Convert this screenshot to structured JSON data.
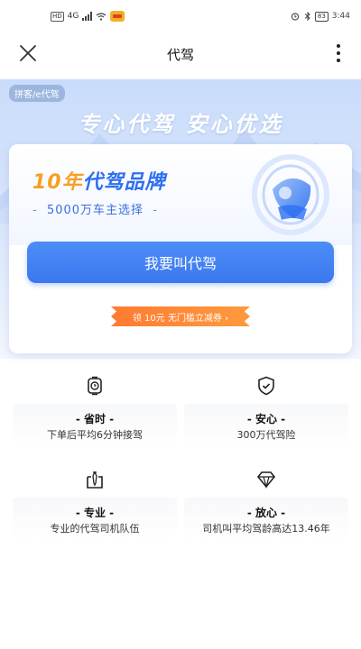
{
  "status_bar": {
    "network_hd": "HD",
    "network_type": "4G",
    "battery": "83",
    "time": "3:44"
  },
  "nav": {
    "title": "代驾",
    "icons": {
      "close": "close-icon",
      "more": "more-vertical-icon"
    }
  },
  "hero": {
    "tag": "拼客/e代驾",
    "slogan": "专心代驾 安心优选",
    "brand_prefix": "10年",
    "brand_suffix": "代驾品牌",
    "sub_dash_left": "-",
    "subtitle": "5000万车主选择",
    "sub_dash_right": "-",
    "call_button": "我要叫代驾",
    "coupon": "领 10元 无门槛立减券 ›"
  },
  "features": [
    {
      "icon": "clock-icon",
      "title": "- 省时 -",
      "desc": "下单后平均6分钟接驾"
    },
    {
      "icon": "shield-check-icon",
      "title": "- 安心 -",
      "desc": "300万代驾险"
    },
    {
      "icon": "driver-tie-icon",
      "title": "- 专业 -",
      "desc": "专业的代驾司机队伍"
    },
    {
      "icon": "diamond-icon",
      "title": "- 放心 -",
      "desc": "司机叫平均驾龄高达13.46年"
    }
  ],
  "colors": {
    "primary": "#3b78ef",
    "brand_orange": "#f5a023",
    "coupon": "#ff7a32"
  }
}
